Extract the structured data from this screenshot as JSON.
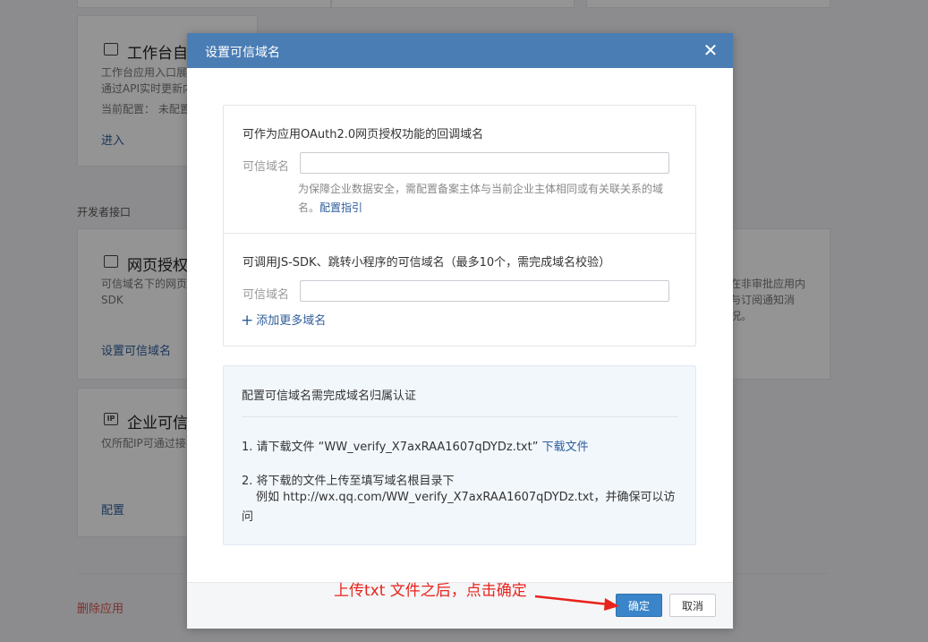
{
  "background": {
    "card_workbench": {
      "title": "工作台自定",
      "desc1": "工作台应用入口展",
      "desc2": "通过API实时更新内",
      "config": "当前配置： 未配置",
      "link": "进入"
    },
    "section_label": "开发者接口",
    "card_oauth": {
      "title": "网页授权及",
      "desc1": "可信域名下的网页",
      "desc2": "SDK",
      "link": "设置可信域名"
    },
    "card_right": {
      "line1": "在非审批应用内",
      "line2": "与订阅通知消",
      "line3": "况。"
    },
    "card_ip": {
      "title": "企业可信I",
      "desc1": "仅所配IP可通过接",
      "link": "配置"
    },
    "delete_link": "删除应用"
  },
  "dialog": {
    "title": "设置可信域名",
    "close": "✕",
    "oauth_heading": "可作为应用OAuth2.0网页授权功能的回调域名",
    "domain_label": "可信域名",
    "oauth_input_value": "",
    "hint_text": "为保障企业数据安全，需配置备案主体与当前企业主体相同或有关联关系的域名。",
    "hint_link": "配置指引",
    "jssdk_heading": "可调用JS-SDK、跳转小程序的可信域名（最多10个，需完成域名校验）",
    "jssdk_input_value": "",
    "add_more": "添加更多域名",
    "verify": {
      "title": "配置可信域名需完成域名归属认证",
      "step1": "1. 请下载文件 “WW_verify_X7axRAA1607qDYDz.txt”",
      "step1_link": "下载文件",
      "step2": "2. 将下载的文件上传至填写域名根目录下",
      "step2_detail": "例如 http://wx.qq.com/WW_verify_X7axRAA1607qDYDz.txt，并确保可以访问"
    },
    "confirm": "确定",
    "cancel": "取消"
  },
  "annotation": {
    "text": "上传txt 文件之后，点击确定",
    "color": "#e8231b"
  },
  "colors": {
    "header": "#4a7db4",
    "primary_button": "#3a85c9",
    "link": "#2f5d9a"
  }
}
